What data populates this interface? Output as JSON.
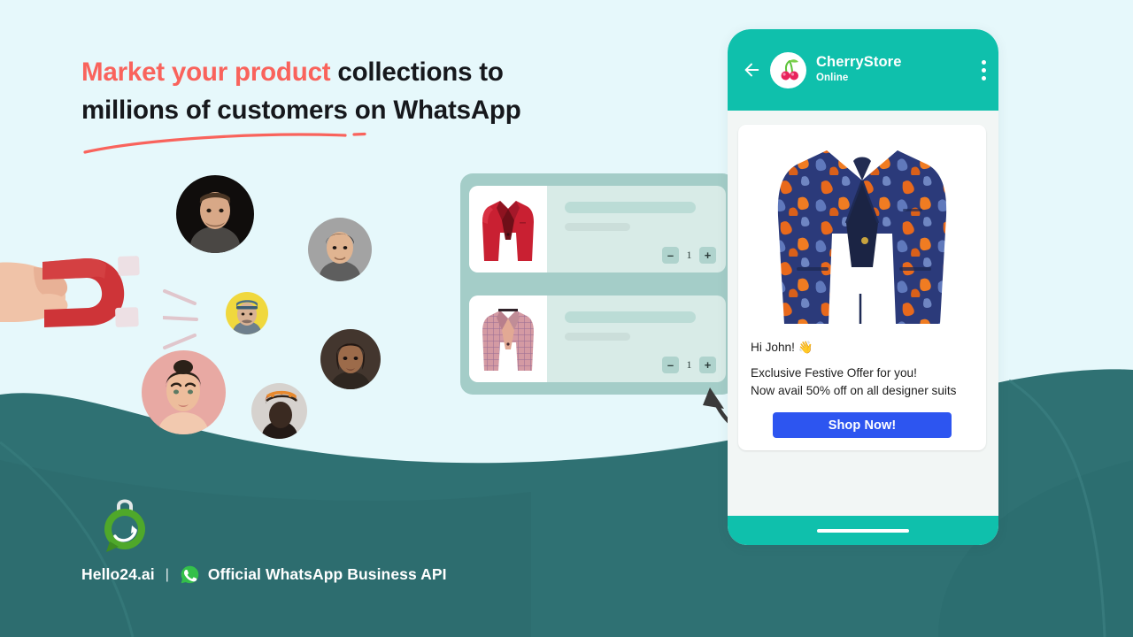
{
  "theme": {
    "background": "#E6F8FB",
    "wave": "#2F7173",
    "wave_dark": "#2A6668",
    "accent_red": "#F9635C",
    "teal": "#0FC0AC",
    "cta_blue": "#2D55F0",
    "brand_green": "#4CAF2E",
    "cart_panel": "#A4CDC8",
    "cart_row": "#D8EBE7"
  },
  "headline": {
    "accent_text": "Market your product",
    "rest_text": " collections to",
    "line2": "millions of customers on WhatsApp"
  },
  "cart": {
    "rows": [
      {
        "product": "red-blazer",
        "quantity": "1",
        "minus_label": "–",
        "plus_label": "+"
      },
      {
        "product": "pink-plaid-blazer",
        "quantity": "1",
        "minus_label": "–",
        "plus_label": "+"
      }
    ]
  },
  "phone": {
    "header": {
      "back_icon": "arrow-left-icon",
      "avatar_icon": "cherry-logo-icon",
      "store_name": "CherryStore",
      "status": "Online",
      "menu_icon": "kebab-menu-icon"
    },
    "message": {
      "product_image": "navy-orange-floral-blazer",
      "greeting": "Hi John! 👋",
      "body_line1": "Exclusive Festive Offer for you!",
      "body_line2": "Now avail 50% off on all designer suits",
      "cta_label": "Shop Now!"
    }
  },
  "footer": {
    "logo_icon": "hello24-logo-icon",
    "brand_name": "Hello24.ai",
    "separator": "|",
    "whatsapp_icon": "whatsapp-icon",
    "tagline": "Official WhatsApp Business API"
  },
  "avatars": [
    {
      "name": "avatar-man-dark-bg",
      "bg": "#0d0b0a"
    },
    {
      "name": "avatar-young-man-grey-bg",
      "bg": "#9b9b9b"
    },
    {
      "name": "avatar-older-man-yellow-bg",
      "bg": "#F2D93B"
    },
    {
      "name": "avatar-woman-pink-bg",
      "bg": "#E8A9A3"
    },
    {
      "name": "avatar-woman-headwrap",
      "bg": "#d8d4d0"
    },
    {
      "name": "avatar-woman-dark-bg",
      "bg": "#3a2f2a"
    }
  ]
}
